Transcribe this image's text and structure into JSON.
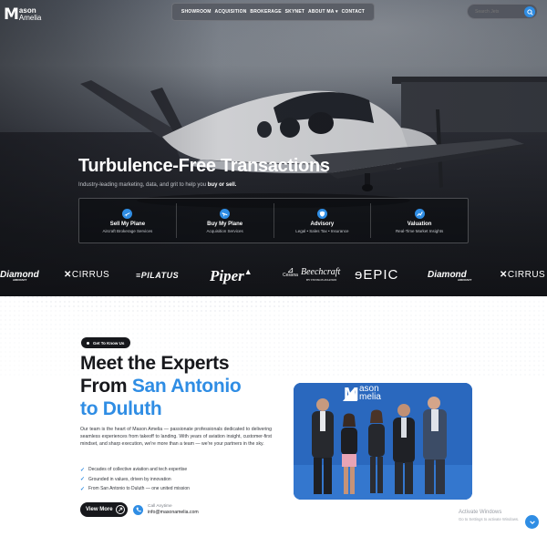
{
  "brand": {
    "logo_mark": "M",
    "logo_line1": "ason",
    "logo_line2": "Amelia"
  },
  "nav": {
    "items": [
      "SHOWROOM",
      "ACQUISITION",
      "BROKERAGE",
      "SKYNET",
      "ABOUT MA ▾",
      "CONTACT"
    ]
  },
  "search": {
    "placeholder": "Search Jets"
  },
  "hero": {
    "title": "Turbulence-Free Transactions",
    "subtitle_pre": "Industry-leading marketing, data, and grit to help you ",
    "subtitle_bold": "buy or sell."
  },
  "services": [
    {
      "title": "Sell My Plane",
      "desc": "Aircraft Brokerage Services",
      "icon": "plane-takeoff-icon"
    },
    {
      "title": "Buy My Plane",
      "desc": "Acquisition Services",
      "icon": "plane-landing-icon"
    },
    {
      "title": "Advisory",
      "desc": "Legal • Sales Tax • Insurance",
      "icon": "shield-icon"
    },
    {
      "title": "Valuation",
      "desc": "Real-Time Market Insights",
      "icon": "chart-icon"
    }
  ],
  "brands": [
    "Diamond",
    "CIRRUS",
    "PILATUS",
    "Piper",
    "Cessna",
    "Beechcraft",
    "EPIC",
    "Diamond",
    "CIRRUS"
  ],
  "brand_sub": {
    "diamond": "AIRCRAFT",
    "beechcraft": "BY TEXTRON AVIATION"
  },
  "about": {
    "tag": "Get To Know Us",
    "heading_line1": "Meet the Experts",
    "heading_line2_pre": "From ",
    "heading_line2_blue": "San Antonio",
    "heading_line3_blue": "to Duluth",
    "body": "Our team is the heart of Mason Amelia — passionate professionals dedicated to delivering seamless experiences from takeoff to landing. With years of aviation insight, customer-first mindset, and sharp execution, we're more than a team — we're your partners in the sky.",
    "checks": [
      "Decades of collective aviation and tech expertise",
      "Grounded in values, driven by innovation",
      "From San Antonio to Duluth — one united mission"
    ],
    "view_more": "View More",
    "call_label": "Call Anytime",
    "call_email": "info@masonamelia.com"
  },
  "photo_banner": {
    "line1": "ason",
    "line2": "melia"
  },
  "windows": {
    "line1": "Activate Windows",
    "line2": "Go to Settings to activate Windows."
  },
  "colors": {
    "accent": "#2f8de4",
    "dark": "#17181c"
  }
}
